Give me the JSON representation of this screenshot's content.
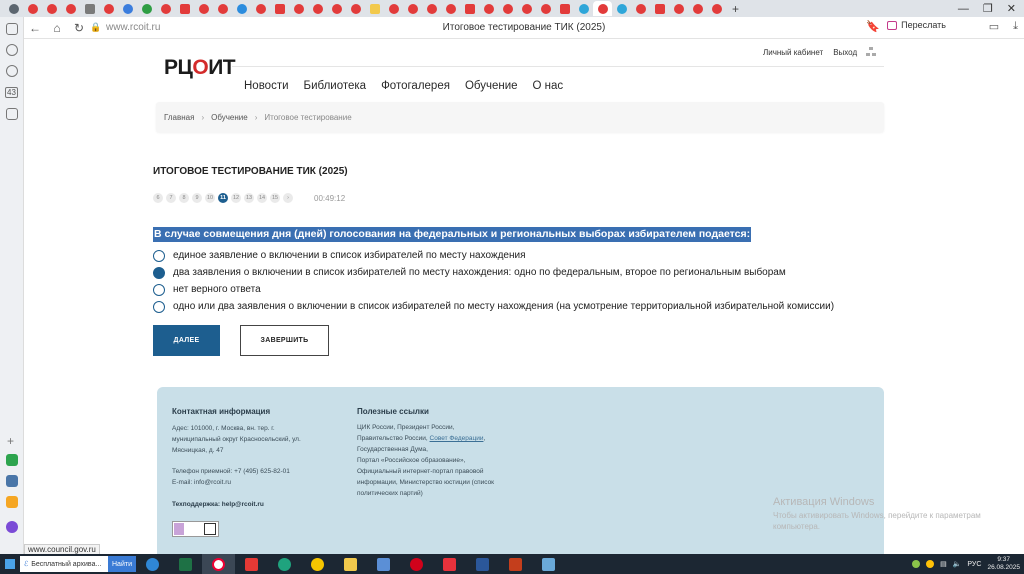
{
  "browser": {
    "url": "www.rcoit.ru",
    "tab_title": "Итоговое тестирование ТИК (2025)",
    "share_label": "Переслать",
    "status_url": "www.council.gov.ru"
  },
  "site": {
    "logo_text_left": "РЦ",
    "logo_check": "О",
    "logo_text_right": "ИТ",
    "top_links": [
      "Личный кабинет",
      "Выход"
    ],
    "nav": [
      "Новости",
      "Библиотека",
      "Фотогалерея",
      "Обучение",
      "О нас"
    ],
    "breadcrumb": [
      "Главная",
      "Обучение",
      "Итоговое тестирование"
    ]
  },
  "test": {
    "title": "ИТОГОВОЕ ТЕСТИРОВАНИЕ ТИК (2025)",
    "pages": [
      "6",
      "7",
      "8",
      "9",
      "10",
      "11",
      "12",
      "13",
      "14",
      "15",
      "›"
    ],
    "active_page": "11",
    "timer": "00:49:12",
    "question": "В случае совмещения дня (дней) голосования на федеральных и региональных выборах избирателем подается:",
    "options": [
      "единое заявление о включении в список избирателей по месту нахождения",
      "два заявления о включении в список избирателей по месту нахождения: одно по федеральным, второе по региональным выборам",
      "нет верного ответа",
      "одно или два заявления о включении в список избирателей по месту нахождения (на усмотрение территориальной избирательной комиссии)"
    ],
    "selected_option": 1,
    "next_label": "ДАЛЕЕ",
    "finish_label": "ЗАВЕРШИТЬ"
  },
  "footer": {
    "contact_heading": "Контактная информация",
    "address": "Адес: 101000, г. Москва, вн. тер. г. муниципальный округ Красносельский, ул. Мясницкая, д. 47",
    "phone": "Телефон приемной: +7 (495) 625-82-01",
    "email": "E-mail: info@rcoit.ru",
    "support": "Техподдержка: help@rcoit.ru",
    "links_heading": "Полезные ссылки",
    "links_1": "ЦИК России, Президент России,",
    "links_2a": "Правительство России,",
    "links_2b": "Совет Федерации",
    "links_3": "Государственная Дума,",
    "links_4": "Портал «Российское образование»,",
    "links_5": "Официальный интернет-портал правовой",
    "links_6": "информации, Министерство юстиции (список",
    "links_7": "политических партий)"
  },
  "os": {
    "activation_title": "Активация Windows",
    "activation_text": "Чтобы активировать Windows, перейдите к параметрам компьютера.",
    "search_text": "Бесплатный архива...",
    "search_button": "Найти",
    "lang": "РУС",
    "time": "9:37",
    "date": "26.08.2025"
  },
  "colors": {
    "accent": "#1d5e8f",
    "question_highlight": "#3a6fb2",
    "footer_bg": "#c9dfe8",
    "logo_check": "#d32b2b"
  }
}
